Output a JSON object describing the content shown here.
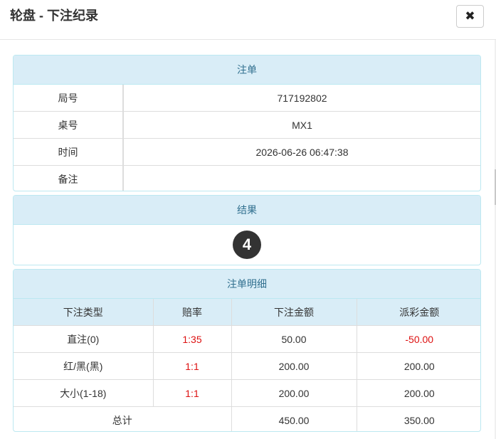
{
  "modal": {
    "title": "轮盘 - 下注纪录",
    "close_icon": "✖"
  },
  "bet": {
    "heading": "注单",
    "rows": [
      {
        "label": "局号",
        "value": "717192802"
      },
      {
        "label": "桌号",
        "value": "MX1"
      },
      {
        "label": "时间",
        "value": "2026-06-26 06:47:38"
      },
      {
        "label": "备注",
        "value": ""
      }
    ]
  },
  "result": {
    "heading": "结果",
    "number": "4"
  },
  "detail": {
    "heading": "注单明细",
    "columns": [
      "下注类型",
      "赔率",
      "下注金额",
      "派彩金额"
    ],
    "rows": [
      {
        "type": "直注(0)",
        "odds": "1:35",
        "amount": "50.00",
        "payout": "-50.00"
      },
      {
        "type": "红/黑(黑)",
        "odds": "1:1",
        "amount": "200.00",
        "payout": "200.00"
      },
      {
        "type": "大小(1-18)",
        "odds": "1:1",
        "amount": "200.00",
        "payout": "200.00"
      }
    ],
    "total": {
      "label": "总计",
      "amount": "450.00",
      "payout": "350.00"
    }
  },
  "colors": {
    "panel_heading_bg": "#d9edf7",
    "panel_heading_text": "#31708f",
    "loss_red": "#dd1111",
    "ball_bg": "#333333"
  }
}
